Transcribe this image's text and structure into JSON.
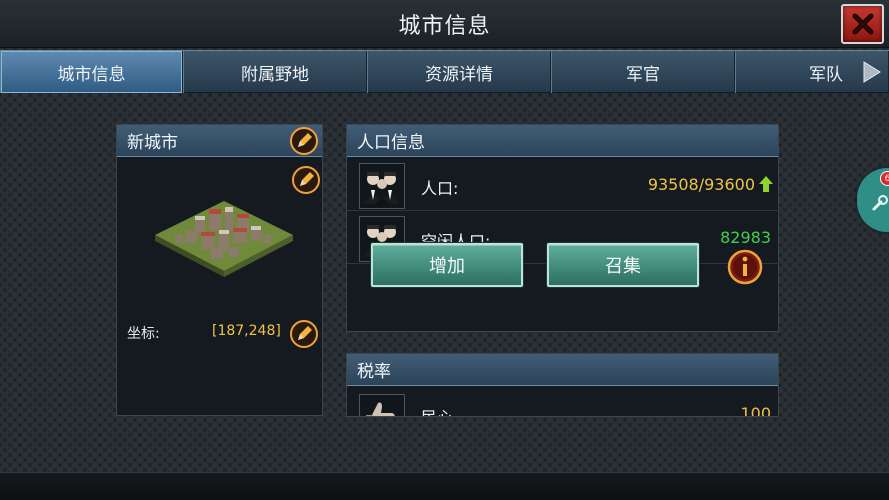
{
  "window": {
    "title": "城市信息"
  },
  "tabs": [
    {
      "label": "城市信息",
      "active": true
    },
    {
      "label": "附属野地"
    },
    {
      "label": "资源详情"
    },
    {
      "label": "军官"
    },
    {
      "label": "军队"
    }
  ],
  "city_panel": {
    "title": "新城市",
    "coord_label": "坐标:",
    "coord_value": "[187,248]"
  },
  "population_panel": {
    "title": "人口信息",
    "rows": [
      {
        "label": "人口:",
        "value": "93508/93600",
        "value_color": "#f0c347",
        "trend_icon": "up-arrow-icon"
      },
      {
        "label": "空闲人口:",
        "value": "82983",
        "value_color": "#3fd04a"
      }
    ],
    "buttons": {
      "increase": "增加",
      "recruit": "召集"
    }
  },
  "tax_panel": {
    "title": "税率",
    "rows": [
      {
        "label": "民心",
        "value": "100"
      }
    ]
  },
  "side_widget": {
    "badge": "6"
  },
  "colors": {
    "gold": "#f0c347",
    "green": "#3fd04a",
    "accent_blue": "#2f5b82"
  }
}
